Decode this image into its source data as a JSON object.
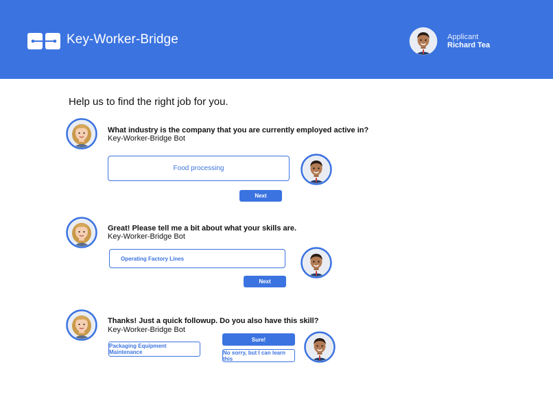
{
  "header": {
    "brand": "Key-Worker-Bridge",
    "applicant_role": "Applicant",
    "applicant_name": "Richard Tea",
    "accent_color": "#3b73e0"
  },
  "page_title": "Help us to find the right job for you.",
  "conversation": [
    {
      "question": "What industry is the company that you are currently employed active in?",
      "sender": "Key-Worker-Bridge Bot",
      "answer": "Food processing",
      "next_label": "Next"
    },
    {
      "question": "Great! Please tell me a bit about what your skills are.",
      "sender": "Key-Worker-Bridge Bot",
      "answer": "Operating Factory Lines",
      "next_label": "Next"
    },
    {
      "question": "Thanks! Just a quick followup. Do you also have this skill?",
      "sender": "Key-Worker-Bridge Bot",
      "skill": "Packaging Equipment Maintenance",
      "yes_label": "Sure!",
      "no_label": "No sorry, but I can learn this"
    }
  ]
}
